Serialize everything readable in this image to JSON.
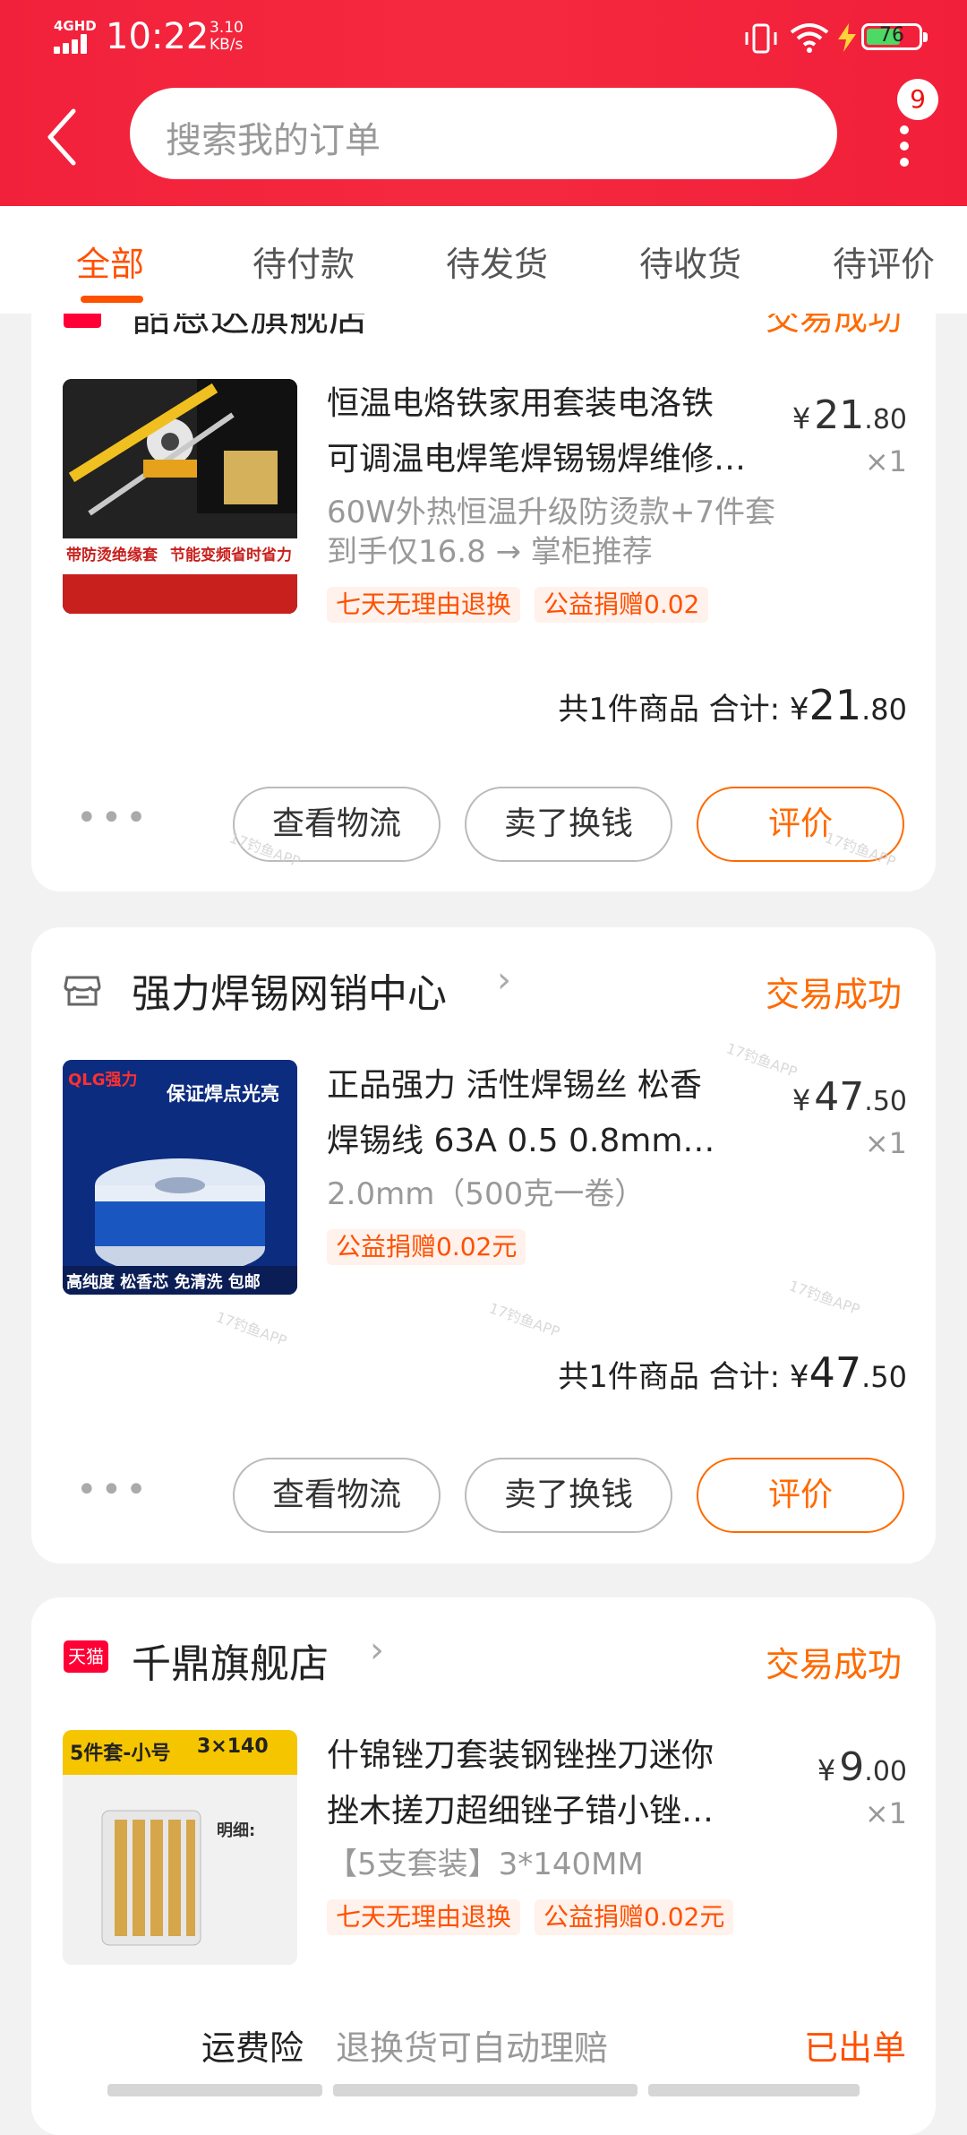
{
  "status_bar": {
    "network": "4GHD",
    "time": "10:22",
    "speed_value": "3.10",
    "speed_unit": "KB/s",
    "battery": "76"
  },
  "header": {
    "search_placeholder": "搜索我的订单",
    "badge_count": "9"
  },
  "tabs": [
    "全部",
    "待付款",
    "待发货",
    "待收货",
    "待评价"
  ],
  "active_tab": 0,
  "orders": [
    {
      "shop_name": "韶恩达旗舰店",
      "status": "交易成功",
      "title_line1": "恒温电烙铁家用套装电洛铁",
      "title_line2": "可调温电焊笔焊锡锡焊维修…",
      "spec": "60W外热恒温升级防烫款+7件套 到手仅16.8 → 掌柜推荐",
      "tags": [
        "七天无理由退换",
        "公益捐赠0.02"
      ],
      "price_int": "21",
      "price_dec": ".80",
      "qty": "×1",
      "total_label": "共1件商品  合计:",
      "total_int": "21",
      "total_dec": ".80",
      "thumb_text_a": "带防烫绝缘套",
      "thumb_text_b": "节能变频省时省力",
      "buttons": [
        "查看物流",
        "卖了换钱",
        "评价"
      ]
    },
    {
      "shop_name": "强力焊锡网销中心",
      "status": "交易成功",
      "title_line1": "正品强力 活性焊锡丝 松香",
      "title_line2": "焊锡线 63A 0.5 0.8mm…",
      "spec": "2.0mm（500克一卷）",
      "tags": [
        "公益捐赠0.02元"
      ],
      "price_int": "47",
      "price_dec": ".50",
      "qty": "×1",
      "total_label": "共1件商品  合计:",
      "total_int": "47",
      "total_dec": ".50",
      "thumb_text_a": "保证焊点光亮",
      "thumb_text_b": "高纯度 松香芯 免清洗 包邮",
      "thumb_brand": "QLG强力",
      "buttons": [
        "查看物流",
        "卖了换钱",
        "评价"
      ]
    },
    {
      "shop_name": "千鼎旗舰店",
      "status": "交易成功",
      "title_line1": "什锦锉刀套装钢锉挫刀迷你",
      "title_line2": "挫木搓刀超细锉子错小锉…",
      "spec": "【5支套装】3*140MM",
      "tags": [
        "七天无理由退换",
        "公益捐赠0.02元"
      ],
      "price_int": "9",
      "price_dec": ".00",
      "qty": "×1",
      "thumb_text_a": "5件套-小号",
      "thumb_text_b": "3×140",
      "thumb_text_c": "明细:",
      "tmall_label": "天猫"
    }
  ],
  "insurance": {
    "label": "运费险",
    "text": "退换货可自动理赔",
    "status": "已出单"
  },
  "watermark": "17钓鱼APP",
  "colors": {
    "header_red": "#f2213b",
    "accent_orange": "#ff5000",
    "status_orange": "#ff6a00"
  }
}
